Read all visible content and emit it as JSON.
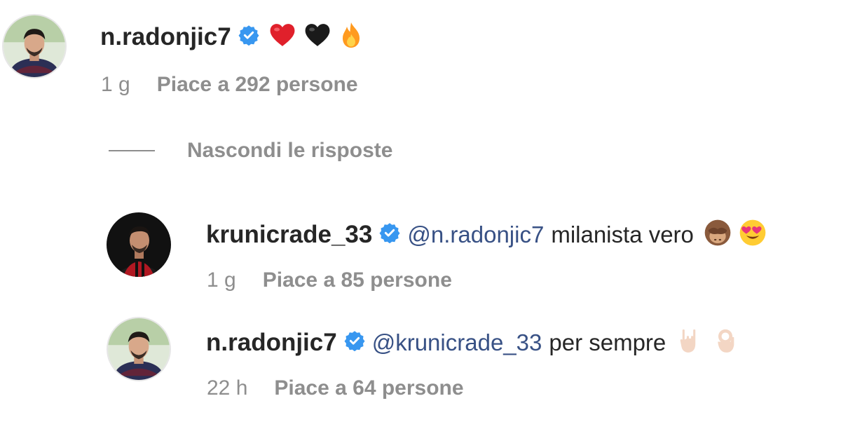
{
  "comments": [
    {
      "username": "n.radonjic7",
      "mention": "",
      "text": "",
      "time": "1 g",
      "likes": "Piace a 292 persone"
    },
    {
      "username": "krunicrade_33",
      "mention": "@n.radonjic7",
      "text": "milanista vero",
      "time": "1 g",
      "likes": "Piace a 85 persone"
    },
    {
      "username": "n.radonjic7",
      "mention": "@krunicrade_33",
      "text": "per sempre",
      "time": "22 h",
      "likes": "Piace a 64 persone"
    }
  ],
  "replies_toggle": "Nascondi le risposte",
  "icons": {
    "verified": "verified-badge-icon",
    "emojis_comment1": [
      "red-heart-emoji",
      "black-heart-emoji",
      "fire-emoji"
    ],
    "emojis_comment2": [
      "see-no-evil-monkey-emoji",
      "heart-eyes-emoji"
    ],
    "emojis_comment3": [
      "rock-on-hand-emoji",
      "ok-hand-emoji"
    ]
  },
  "colors": {
    "text": "#262626",
    "secondary": "#8e8e8e",
    "mention": "#385185",
    "verified": "#3897f0"
  }
}
